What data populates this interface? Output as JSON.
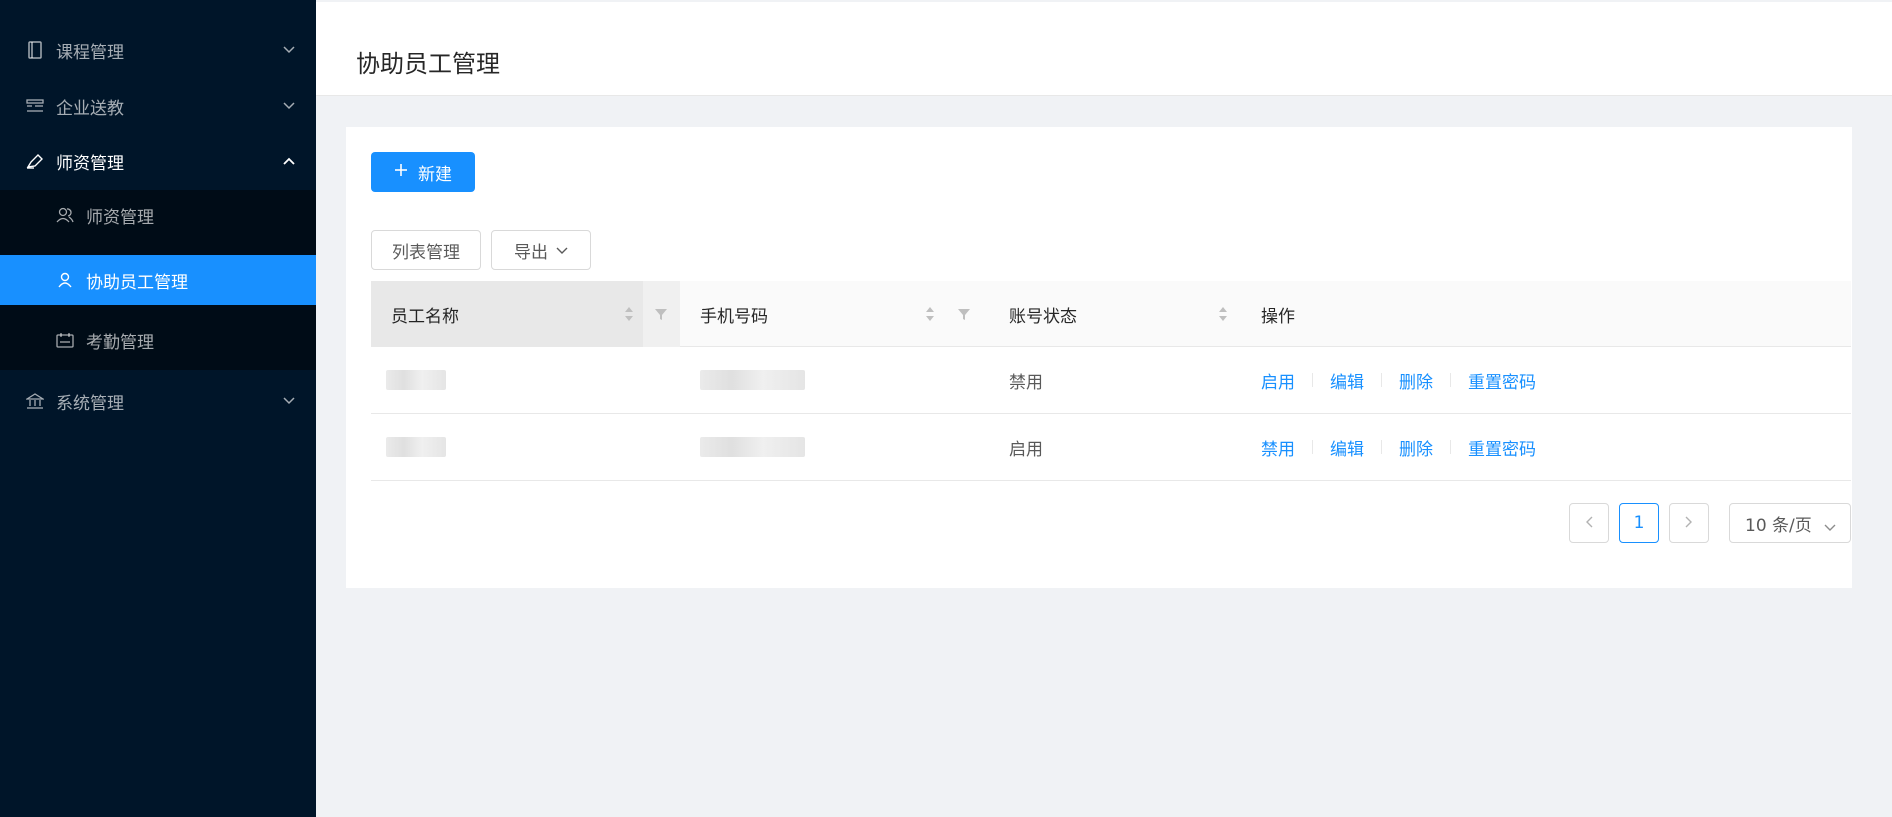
{
  "sidebar": {
    "items": [
      {
        "label": "课程管理",
        "icon": "book-icon",
        "expanded": false
      },
      {
        "label": "企业送教",
        "icon": "list-icon",
        "expanded": false
      },
      {
        "label": "师资管理",
        "icon": "highlight-icon",
        "expanded": true
      },
      {
        "label": "系统管理",
        "icon": "bank-icon",
        "expanded": false
      }
    ],
    "submenu": [
      {
        "label": "师资管理",
        "icon": "team-icon"
      },
      {
        "label": "协助员工管理",
        "icon": "user-icon",
        "active": true
      },
      {
        "label": "考勤管理",
        "icon": "calendar-icon"
      }
    ]
  },
  "header": {
    "title": "协助员工管理"
  },
  "toolbar": {
    "new_label": "新建",
    "list_manage_label": "列表管理",
    "export_label": "导出"
  },
  "table": {
    "columns": [
      "员工名称",
      "手机号码",
      "账号状态",
      "操作"
    ],
    "rows": [
      {
        "status": "禁用",
        "actions": [
          "启用",
          "编辑",
          "删除",
          "重置密码"
        ]
      },
      {
        "status": "启用",
        "actions": [
          "禁用",
          "编辑",
          "删除",
          "重置密码"
        ]
      }
    ]
  },
  "pagination": {
    "current_page": "1",
    "page_size": "10 条/页"
  },
  "colors": {
    "primary": "#1890ff",
    "sidebar_bg": "#001529",
    "submenu_bg": "#000c17"
  }
}
